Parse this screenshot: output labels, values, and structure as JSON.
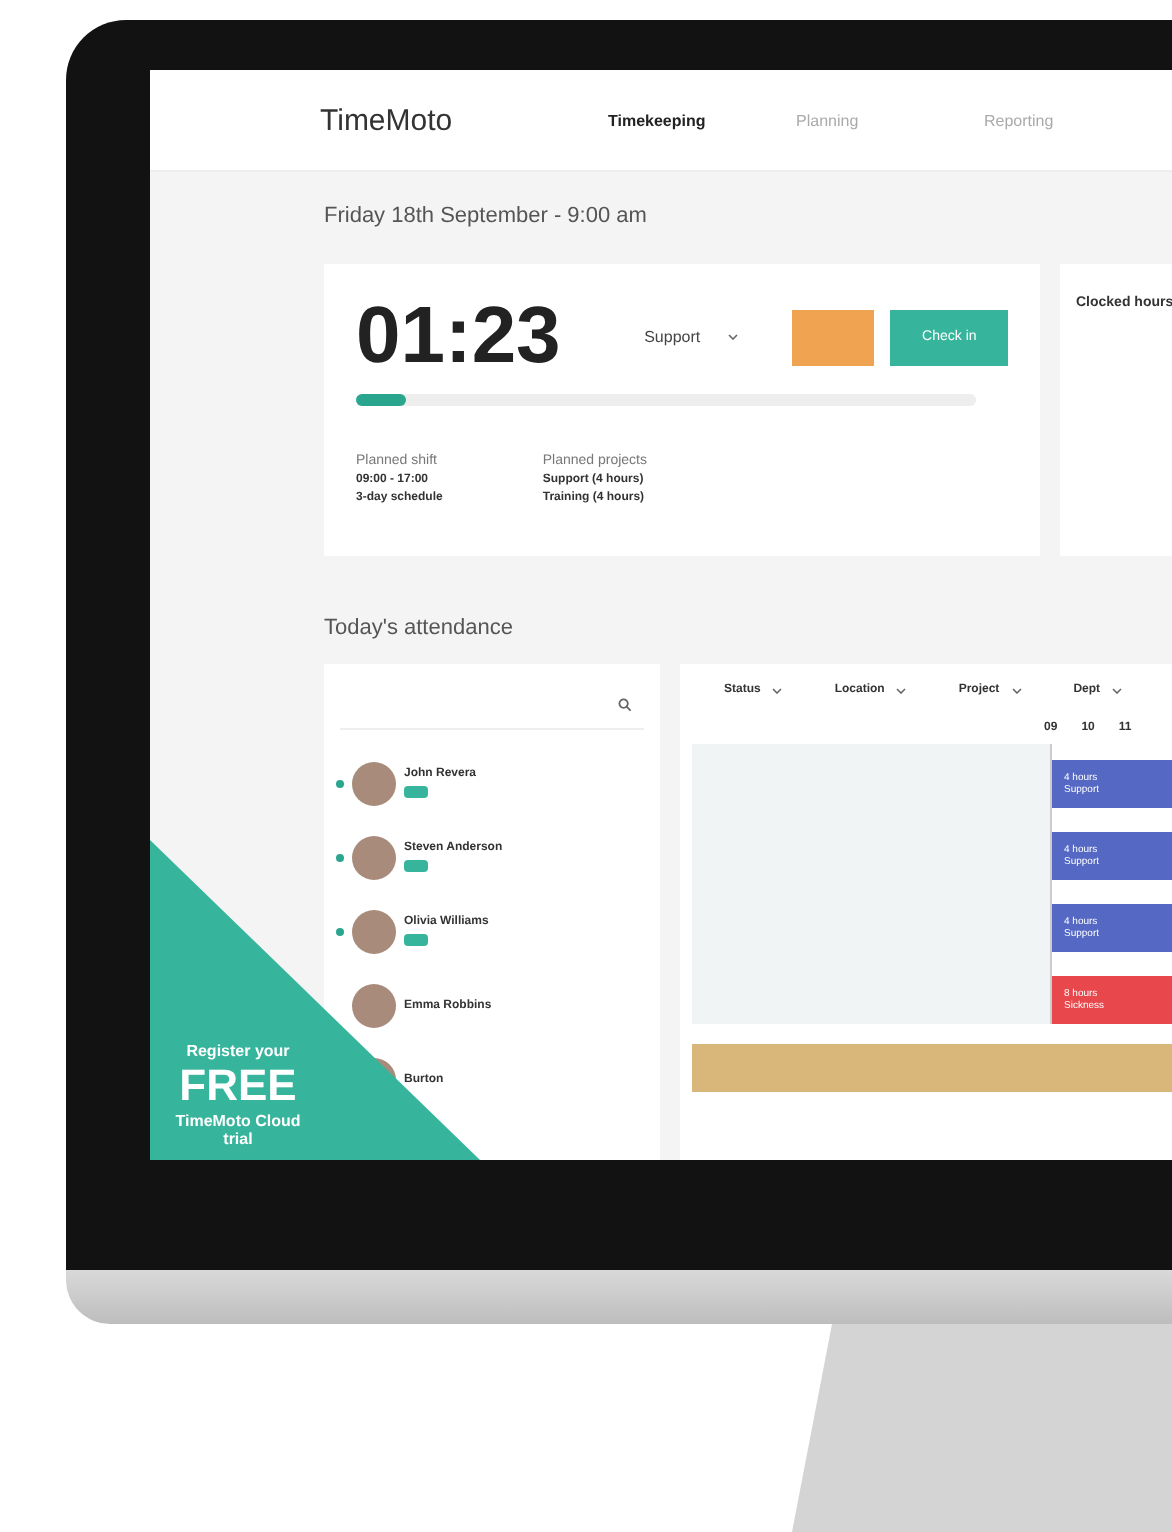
{
  "header": {
    "logo": "TimeMoto",
    "nav": [
      {
        "label": "Timekeeping",
        "selected": true
      },
      {
        "label": "Planning",
        "selected": false
      },
      {
        "label": "Reporting",
        "selected": false
      }
    ]
  },
  "date": "Friday 18th September - 9:00 am",
  "timer": {
    "time": "01:23",
    "project": "Support",
    "check_in": "Check in",
    "level": 0.08
  },
  "plan": [
    {
      "label": "Planned shift",
      "lines": [
        "09:00 - 17:00",
        "3-day schedule"
      ]
    },
    {
      "label": "Planned projects",
      "lines": [
        "Support (4 hours)",
        "Training (4 hours)"
      ]
    }
  ],
  "clocked": {
    "title": "Clocked hours"
  },
  "attendance": {
    "title": "Today's attendance",
    "filters": [
      "Status",
      "Location",
      "Project",
      "Dept"
    ],
    "hours": [
      "09",
      "10",
      "11"
    ],
    "people": [
      {
        "name": "John Revera",
        "present": true,
        "shift": [
          "4 hours",
          "Support"
        ],
        "color": "#5468c4"
      },
      {
        "name": "Steven Anderson",
        "present": true,
        "shift": [
          "4 hours",
          "Support"
        ],
        "color": "#5468c4"
      },
      {
        "name": "Olivia Williams",
        "present": true,
        "shift": [
          "4 hours",
          "Support"
        ],
        "color": "#5468c4"
      },
      {
        "name": "Emma Robbins",
        "present": false,
        "shift": [
          "8 hours",
          "Sickness"
        ],
        "color": "#e8474c"
      },
      {
        "name": "Burton"
      }
    ]
  },
  "promo": {
    "lead": "Register your",
    "big": "FREE",
    "tail": "TimeMoto Cloud trial"
  }
}
